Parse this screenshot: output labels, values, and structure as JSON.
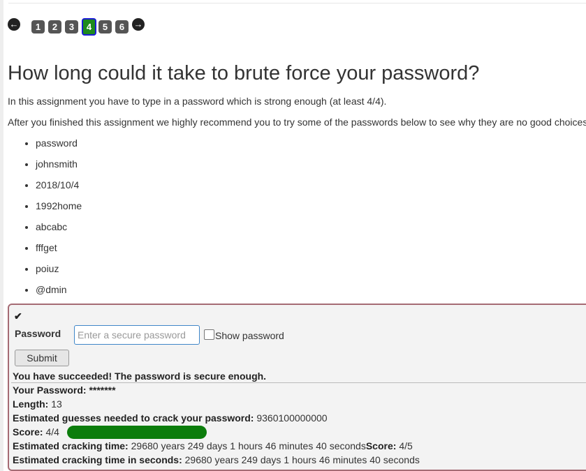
{
  "pagination": {
    "prev_icon": "arrow-left-circle-icon",
    "next_icon": "arrow-right-circle-icon",
    "pages": [
      "1",
      "2",
      "3",
      "4",
      "5",
      "6"
    ],
    "current_page": "4"
  },
  "assignment": {
    "title": "How long could it take to brute force your password?",
    "intro": "In this assignment you have to type in a password which is strong enough (at least 4/4).",
    "recommendation": "After you finished this assignment we highly recommend you to try some of the passwords below to see why they are no good choices",
    "example_passwords": [
      "password",
      "johnsmith",
      "2018/10/4",
      "1992home",
      "abcabc",
      "fffget",
      "poiuz",
      "@dmin"
    ]
  },
  "form": {
    "status_icon": "checkmark-icon",
    "password_label": "Password",
    "password_placeholder": "Enter a secure password",
    "password_value": "",
    "show_password_label": "Show password",
    "show_password_checked": false,
    "submit_label": "Submit"
  },
  "result": {
    "message": "You have succeeded! The password is secure enough.",
    "your_password_label": "Your Password:",
    "your_password_value": "*******",
    "length_label": "Length:",
    "length_value": "13",
    "guesses_label": "Estimated guesses needed to crack your password:",
    "guesses_value": "9360100000000",
    "score_label": "Score:",
    "score_value": "4/4",
    "score_fraction": 1.0,
    "score_color": "#0c7d0c",
    "cracking_time_label": "Estimated cracking time:",
    "cracking_time_value": "29680 years 249 days 1 hours 46 minutes 40 seconds",
    "score_inline_label": "Score:",
    "score_inline_value": "4/5",
    "cracking_seconds_label": "Estimated cracking time in seconds:",
    "cracking_seconds_value": "29680 years 249 days 1 hours 46 minutes 40 seconds"
  },
  "colors": {
    "current_page_bg": "#1e8a1e",
    "current_page_border": "#1b1bd6",
    "page_bg": "#555555",
    "panel_border": "#a56b74"
  }
}
